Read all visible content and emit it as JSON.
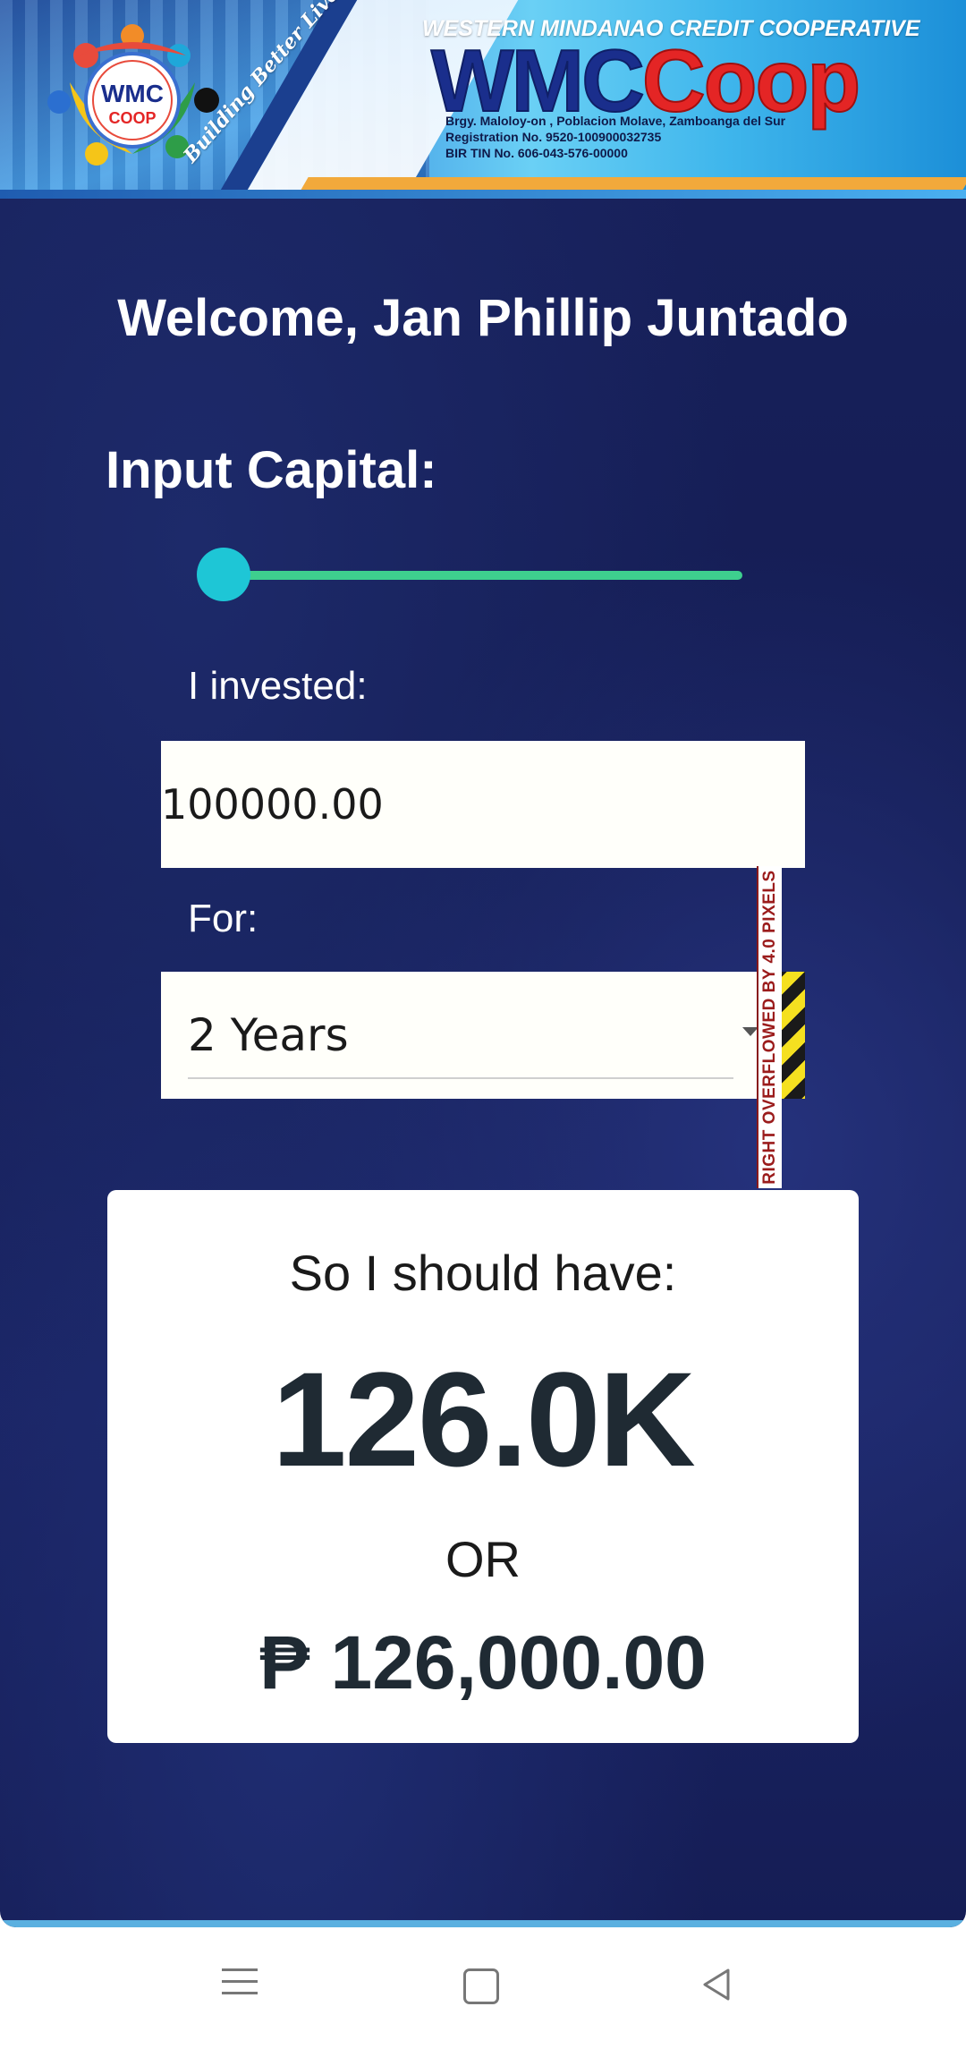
{
  "header": {
    "org_name": "WESTERN MINDANAO CREDIT COOPERATIVE",
    "brand_primary": "WMC",
    "brand_secondary": "Coop",
    "logo_text_top": "WMC",
    "logo_text_bottom": "COOP",
    "tagline": "Building Better Lives Together",
    "address": "Brgy. Maloloy-on , Poblacion Molave, Zamboanga del Sur",
    "registration": "Registration No. 9520-100900032735",
    "tin": "BIR TIN No. 606-043-576-00000"
  },
  "main": {
    "welcome": "Welcome, Jan Phillip Juntado",
    "input_capital_label": "Input Capital:",
    "slider_value_fraction": 0.0,
    "invested_label": "I invested:",
    "invested_value": "100000.00",
    "for_label": "For:",
    "term_selected": "2 Years",
    "overflow_warning": "RIGHT OVERFLOWED BY 4.0 PIXELS"
  },
  "result": {
    "title": "So I should have:",
    "short_value": "126.0K",
    "or_text": "OR",
    "full_value": "₱ 126,000.00"
  },
  "colors": {
    "background": "#17205a",
    "slider_track": "#3ecf8e",
    "slider_thumb": "#1ec6d6",
    "brand_blue": "#1a2e8c",
    "brand_red": "#e42525"
  },
  "navbar": {
    "icons": [
      "menu-icon",
      "home-icon",
      "back-icon"
    ]
  }
}
